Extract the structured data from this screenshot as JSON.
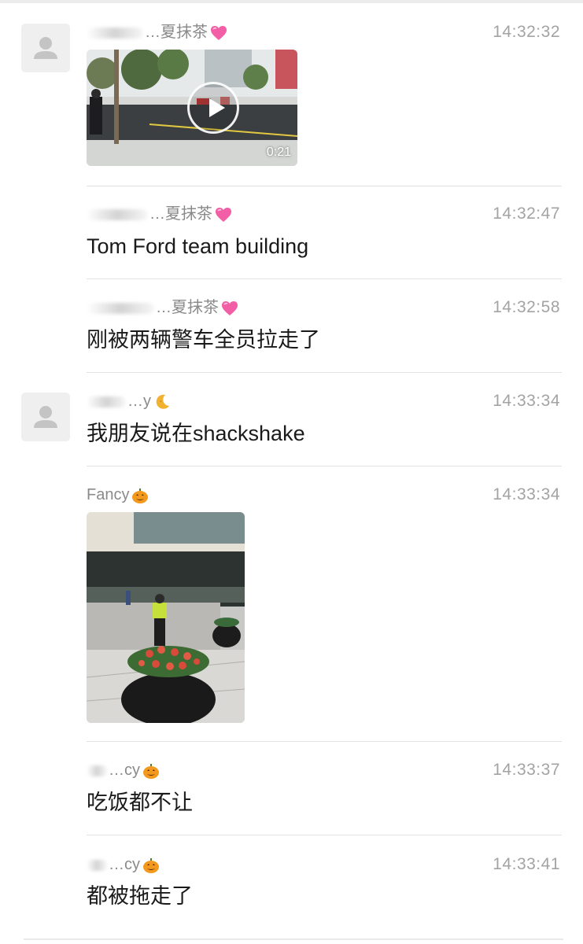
{
  "messages": [
    {
      "sender": "…夏抹茶",
      "time": "14:32:32",
      "type": "video",
      "video": {
        "duration": "0:21"
      }
    },
    {
      "sender": "…夏抹茶",
      "time": "14:32:47",
      "text": "Tom Ford team building"
    },
    {
      "sender": "…夏抹茶",
      "time": "14:32:58",
      "text": "刚被两辆警车全员拉走了"
    },
    {
      "sender": "…y",
      "time": "14:33:34",
      "text": "我朋友说在shackshake"
    },
    {
      "sender": "Fancy",
      "time": "14:33:34",
      "type": "image"
    },
    {
      "sender": "…cy",
      "time": "14:33:37",
      "text": "吃饭都不让"
    },
    {
      "sender": "…cy",
      "time": "14:33:41",
      "text": "都被拖走了"
    }
  ],
  "icons": {
    "avatar": "default-avatar-icon",
    "sender_emoji_1": "pink-heart-icon",
    "sender_emoji_2": "crescent-moon-icon",
    "sender_emoji_3": "pumpkin-icon",
    "video_overlay": "play-icon"
  },
  "colors": {
    "time": "#a3a3a3",
    "sender": "#8a8a8a",
    "text": "#1a1a1a",
    "heart": "#f25fa6",
    "pumpkin": "#f39a1e",
    "moon": "#f2b12f"
  }
}
